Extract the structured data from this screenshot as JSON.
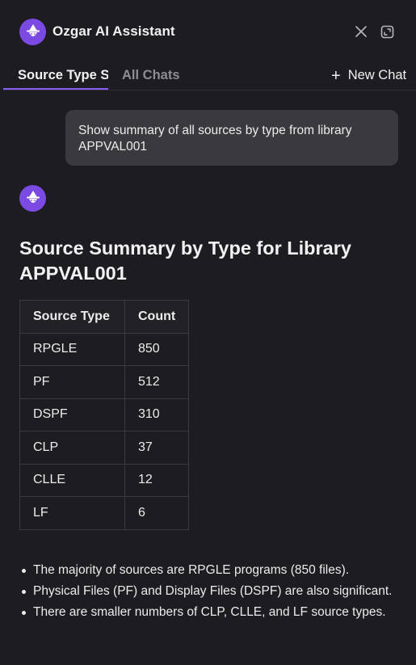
{
  "header": {
    "title": "Ozgar AI Assistant",
    "avatar_icon": "wizard-icon",
    "close_icon": "close-icon",
    "expand_icon": "expand-icon",
    "avatar_color": "#7b4ae2"
  },
  "tabs": {
    "items": [
      {
        "label": "Source Type S",
        "active": true
      },
      {
        "label": "All Chats",
        "active": false
      }
    ],
    "new_chat_icon": "plus-icon",
    "new_chat_label": "New Chat",
    "accent_color": "#8b5cf6"
  },
  "conversation": {
    "user_message": "Show summary of all sources by type from library APPVAL001",
    "assistant": {
      "avatar_icon": "wizard-icon",
      "title": "Source Summary by Type for Library APPVAL001",
      "table": {
        "headers": [
          "Source Type",
          "Count"
        ],
        "rows": [
          [
            "RPGLE",
            "850"
          ],
          [
            "PF",
            "512"
          ],
          [
            "DSPF",
            "310"
          ],
          [
            "CLP",
            "37"
          ],
          [
            "CLLE",
            "12"
          ],
          [
            "LF",
            "6"
          ]
        ]
      },
      "notes": [
        "The majority of sources are RPGLE programs (850 files).",
        "Physical Files (PF) and Display Files (DSPF) are also significant.",
        "There are smaller numbers of CLP, CLLE, and LF source types."
      ]
    }
  }
}
